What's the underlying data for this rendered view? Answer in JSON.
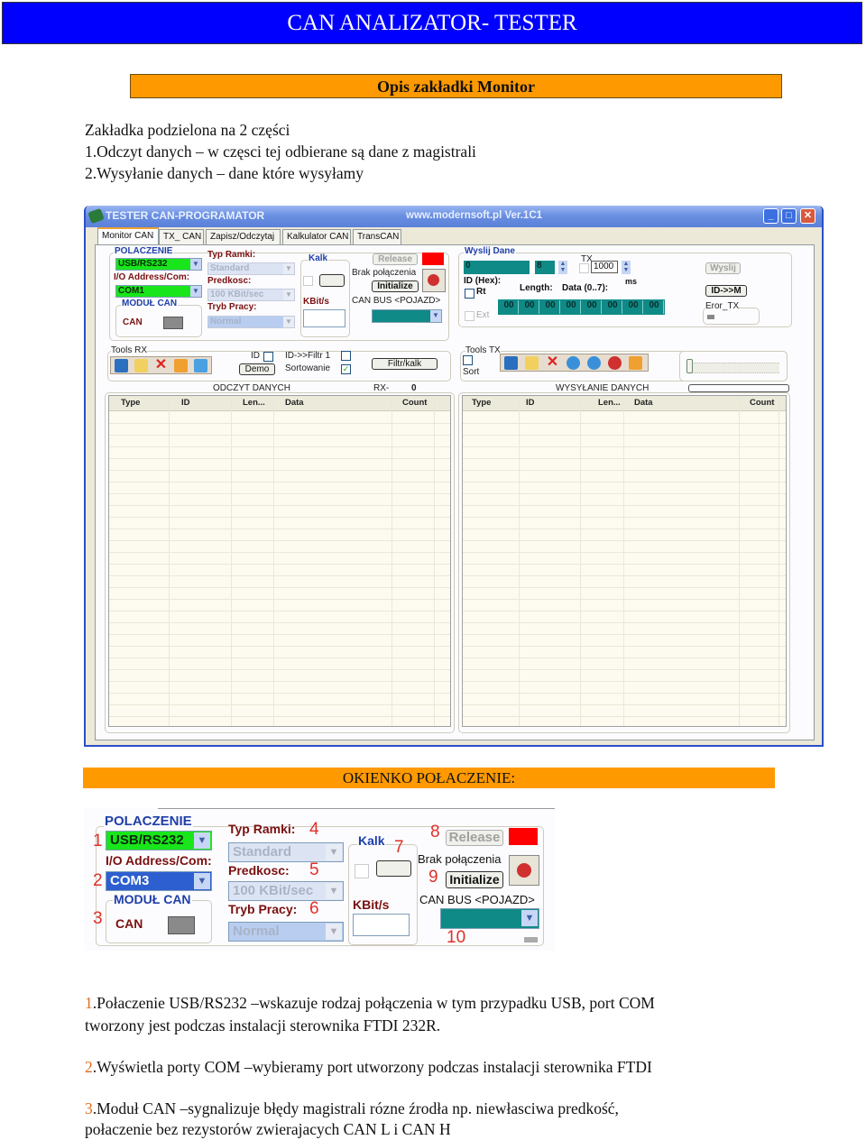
{
  "header": {
    "title": "CAN ANALIZATOR- TESTER",
    "section1": "Opis zakładki Monitor",
    "section2": "OKIENKO POŁACZENIE:"
  },
  "intro": [
    "Zakładka podzielona na 2 części",
    "1.Odczyt danych – w częsci tej odbierane są dane z magistrali",
    "2.Wysyłanie danych – dane które wysyłamy"
  ],
  "app": {
    "title": "TESTER CAN-PROGRAMATOR",
    "url": "www.modernsoft.pl  Ver.1C1",
    "window_buttons": {
      "minimize": "_",
      "maximize": "□",
      "close": "✕"
    },
    "tabs": [
      "Monitor CAN",
      "TX_ CAN",
      "Zapisz/Odczytaj",
      "Kalkulator CAN",
      "TransCAN"
    ],
    "active_tab": "Monitor CAN",
    "connection": {
      "group_label": "POLACZENIE",
      "interface": "USB/RS232",
      "io_label": "I/O Address/Com:",
      "port": "COM1",
      "module_label": "MODUŁ CAN",
      "module_can": "CAN",
      "frame_type_label": "Typ Ramki:",
      "frame_type": "Standard",
      "speed_label": "Predkosc:",
      "speed": "100 KBit/sec",
      "mode_label": "Tryb Pracy:",
      "mode": "Normal",
      "kalk_label": "Kalk",
      "kbit_label": "KBit/s",
      "release_button": "Release",
      "status_text": "Brak połączenia",
      "initialize_button": "Initialize",
      "can_bus_label": "CAN BUS <POJAZD>",
      "status_color": "#ff0000"
    },
    "send": {
      "group_label": "Wyslij Dane",
      "id_value": "0",
      "length_value": "8",
      "tx_label": "TX",
      "interval": "1000",
      "ms_label": "ms",
      "id_hex_label": "ID (Hex):",
      "rt_label": "Rt",
      "length_label": "Length:",
      "data_label": "Data (0..7):",
      "ext_label": "Ext",
      "data_bytes": [
        "00",
        "00",
        "00",
        "00",
        "00",
        "00",
        "00",
        "00"
      ],
      "send_button": "Wyslij",
      "id_m_button": "ID->>M",
      "error_label": "Eror_TX"
    },
    "tools_rx": {
      "label": "Tools RX",
      "icons": [
        "save-icon",
        "folder-icon",
        "delete-icon",
        "clipboard-icon",
        "monitor-icon"
      ],
      "id_label": "ID",
      "demo_button": "Demo",
      "filter_label": "ID->>Filtr 1",
      "sort_label": "Sortowanie",
      "sort_checked": true,
      "filter_button": "Filtr/kalk"
    },
    "tools_tx": {
      "label": "Tools TX",
      "sort_label": "Sort",
      "icons": [
        "save-icon",
        "folder-icon",
        "delete-icon",
        "play-icon",
        "fast-forward-icon",
        "stop-icon",
        "clipboard-icon"
      ]
    },
    "rx_panel": {
      "title": "ODCZYT DANYCH",
      "rx_label": "RX-",
      "rx_count": "0",
      "columns": [
        "Type",
        "ID",
        "Len...",
        "Data",
        "Count"
      ],
      "rows": []
    },
    "tx_panel": {
      "title": "WYSYŁANIE DANYCH",
      "columns": [
        "Type",
        "ID",
        "Len...",
        "Data",
        "Count"
      ],
      "rows": []
    }
  },
  "zoom_panel": {
    "group_label": "POLACZENIE",
    "interface": "USB/RS232",
    "io_label": "I/O Address/Com:",
    "port": "COM3",
    "module_label": "MODUŁ CAN",
    "module_can": "CAN",
    "frame_type_label": "Typ Ramki:",
    "frame_type": "Standard",
    "speed_label": "Predkosc:",
    "speed": "100 KBit/sec",
    "mode_label": "Tryb Pracy:",
    "mode": "Normal",
    "kalk_label": "Kalk",
    "kbit_label": "KBit/s",
    "release_button": "Release",
    "status_text": "Brak połączenia",
    "initialize_button": "Initialize",
    "can_bus_label": "CAN BUS <POJAZD>",
    "markers": [
      "1",
      "2",
      "3",
      "4",
      "5",
      "6",
      "7",
      "8",
      "9",
      "10"
    ]
  },
  "descriptions": [
    {
      "num": "1",
      "text": ".Połaczenie USB/RS232 –wskazuje rodzaj połączenia w tym przypadku USB, port COM",
      "cont": "tworzony jest podczas instalacji sterownika FTDI 232R."
    },
    {
      "num": "2",
      "text": ".Wyświetla porty COM –wybieramy port utworzony podczas instalacji sterownika FTDI"
    },
    {
      "num": "3",
      "text": ".Moduł CAN –sygnalizuje błędy magistrali rózne źrodła np. niewłasciwa predkość,",
      "cont": "połaczenie bez rezystorów zwierajacych CAN L i CAN H"
    }
  ]
}
